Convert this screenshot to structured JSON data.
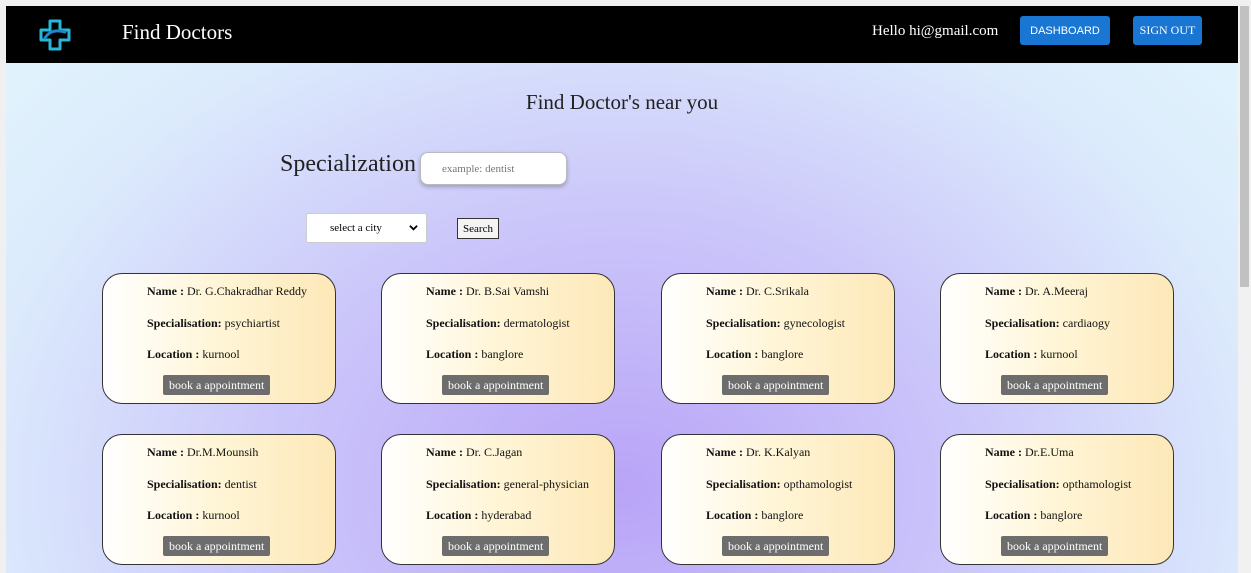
{
  "navbar": {
    "brand": "Find Doctors",
    "greeting": "Hello hi@gmail.com",
    "dashboard_label": "DASHBOARD",
    "signout_label": "SIGN OUT",
    "logo_icon": "medical-cross-icon",
    "accent_color": "#1976d2"
  },
  "main": {
    "title": "Find Doctor's near you",
    "specialization_label": "Specialization",
    "specialization_placeholder": "example: dentist",
    "specialization_value": "",
    "city_selected": "select a city",
    "search_label": "Search"
  },
  "labels": {
    "name": "Name :",
    "specialisation": "Specialisation:",
    "location": "Location :",
    "book": "book a appointment"
  },
  "doctors": [
    {
      "name": "Dr. G.Chakradhar Reddy",
      "specialisation": "psychiartist",
      "location": "kurnool"
    },
    {
      "name": "Dr. B.Sai Vamshi",
      "specialisation": "dermatologist",
      "location": "banglore"
    },
    {
      "name": "Dr. C.Srikala",
      "specialisation": "gynecologist",
      "location": "banglore"
    },
    {
      "name": "Dr. A.Meeraj",
      "specialisation": "cardiaogy",
      "location": "kurnool"
    },
    {
      "name": "Dr.M.Mounsih",
      "specialisation": "dentist",
      "location": "kurnool"
    },
    {
      "name": "Dr. C.Jagan",
      "specialisation": "general-physician",
      "location": "hyderabad"
    },
    {
      "name": "Dr. K.Kalyan",
      "specialisation": "opthamologist",
      "location": "banglore"
    },
    {
      "name": "Dr.E.Uma",
      "specialisation": "opthamologist",
      "location": "banglore"
    }
  ]
}
